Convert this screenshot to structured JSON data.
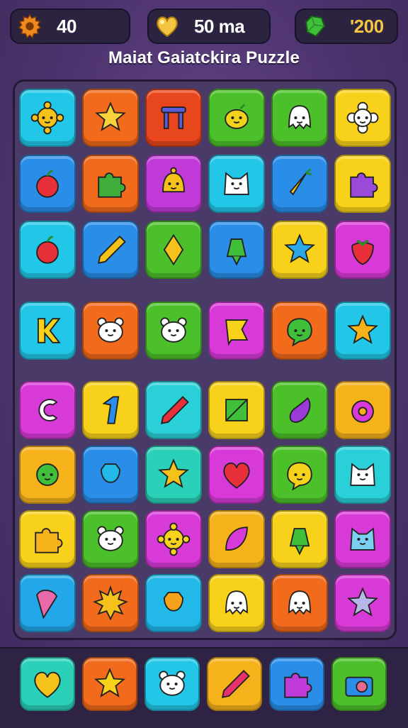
{
  "hud": {
    "left": {
      "value": "40",
      "icon": "gear-coin-icon",
      "color": "#f08a1c"
    },
    "center": {
      "value": "50 ma",
      "icon": "gold-heart-icon",
      "color": "#f5c542"
    },
    "right": {
      "value": "'200",
      "icon": "green-gem-icon",
      "color": "#3fbf3a"
    }
  },
  "title": "Maiat Gaiatckira Puzzle",
  "board": {
    "rows": [
      [
        {
          "bg": "#22c7e8",
          "icon": "sun-face-icon",
          "fg": "#f5c21b"
        },
        {
          "bg": "#f26a1b",
          "icon": "star-icon",
          "fg": "#f7d23a"
        },
        {
          "bg": "#e8461c",
          "icon": "table-icon",
          "fg": "#5a5ed8"
        },
        {
          "bg": "#4cc02a",
          "icon": "lemon-icon",
          "fg": "#f2d21c"
        },
        {
          "bg": "#4cc02a",
          "icon": "ghost-icon",
          "fg": "#ffffff"
        },
        {
          "bg": "#f8d21a",
          "icon": "flower-face-icon",
          "fg": "#ffffff"
        }
      ],
      [
        {
          "bg": "#2a8de8",
          "icon": "apple-icon",
          "fg": "#e8303a"
        },
        {
          "bg": "#f26a1b",
          "icon": "puzzle-piece-icon",
          "fg": "#3fae3a"
        },
        {
          "bg": "#c03ad8",
          "icon": "bell-face-icon",
          "fg": "#f5c21b"
        },
        {
          "bg": "#22c7e8",
          "icon": "cat-face-icon",
          "fg": "#ffffff"
        },
        {
          "bg": "#2a8de8",
          "icon": "carrot-icon",
          "fg": "#f5c21b"
        },
        {
          "bg": "#f8d21a",
          "icon": "puzzle-piece-icon",
          "fg": "#9a4ad8"
        }
      ],
      [
        {
          "bg": "#22c7e8",
          "icon": "apple-icon",
          "fg": "#e8303a"
        },
        {
          "bg": "#2a8de8",
          "icon": "pencil-icon",
          "fg": "#f5c21b"
        },
        {
          "bg": "#4cc02a",
          "icon": "diamond-icon",
          "fg": "#f5c21b"
        },
        {
          "bg": "#2a8de8",
          "icon": "bell-icon",
          "fg": "#3fbf3a"
        },
        {
          "bg": "#f8d21a",
          "icon": "star-icon",
          "fg": "#2aa8e8"
        },
        {
          "bg": "#d83ad8",
          "icon": "strawberry-icon",
          "fg": "#e8303a"
        }
      ],
      [
        {
          "bg": "#22c7e8",
          "icon": "letter-k-icon",
          "fg": "#f8d21a"
        },
        {
          "bg": "#f26a1b",
          "icon": "bear-face-icon",
          "fg": "#ffffff"
        },
        {
          "bg": "#4cc02a",
          "icon": "bear-face-icon",
          "fg": "#ffffff"
        },
        {
          "bg": "#d83ad8",
          "icon": "flag-icon",
          "fg": "#f8d21a"
        },
        {
          "bg": "#f26a1b",
          "icon": "speech-bubble-face-icon",
          "fg": "#3fbf3a"
        },
        {
          "bg": "#22c7e8",
          "icon": "star-icon",
          "fg": "#f5b21b"
        }
      ],
      [
        {
          "bg": "#d83ad8",
          "icon": "letter-c-icon",
          "fg": "#ffffff"
        },
        {
          "bg": "#f8d21a",
          "icon": "number-one-icon",
          "fg": "#2a8de8"
        },
        {
          "bg": "#2ad0d8",
          "icon": "pencil-icon",
          "fg": "#e8303a"
        },
        {
          "bg": "#f8d21a",
          "icon": "triangle-icon",
          "fg": "#3fbf3a"
        },
        {
          "bg": "#4cc02a",
          "icon": "eggplant-icon",
          "fg": "#9a3ad8"
        },
        {
          "bg": "#f5b21b",
          "icon": "donut-icon",
          "fg": "#d83ad8"
        }
      ],
      [
        {
          "bg": "#f5b21b",
          "icon": "circle-face-icon",
          "fg": "#3fbf3a"
        },
        {
          "bg": "#2a8de8",
          "icon": "bag-icon",
          "fg": "#22b8e8"
        },
        {
          "bg": "#2ad0b8",
          "icon": "star-icon",
          "fg": "#f5c21b"
        },
        {
          "bg": "#d83ad8",
          "icon": "heart-icon",
          "fg": "#e8303a"
        },
        {
          "bg": "#4cc02a",
          "icon": "speech-bubble-face-icon",
          "fg": "#f5d21b"
        },
        {
          "bg": "#2ad0d8",
          "icon": "cat-face-icon",
          "fg": "#ffffff"
        }
      ],
      [
        {
          "bg": "#f8d21a",
          "icon": "puzzle-piece-icon",
          "fg": "#f5b21b"
        },
        {
          "bg": "#4cc02a",
          "icon": "bear-face-icon",
          "fg": "#ffffff"
        },
        {
          "bg": "#d83ad8",
          "icon": "sun-face-icon",
          "fg": "#f5d21b"
        },
        {
          "bg": "#f5b21b",
          "icon": "leaf-icon",
          "fg": "#d83ad8"
        },
        {
          "bg": "#f8d21a",
          "icon": "bell-icon",
          "fg": "#3fbf3a"
        },
        {
          "bg": "#d83ad8",
          "icon": "cat-face-icon",
          "fg": "#7ad0f0"
        }
      ],
      [
        {
          "bg": "#22a8e8",
          "icon": "ice-cream-icon",
          "fg": "#e86aa8"
        },
        {
          "bg": "#f26a1b",
          "icon": "sun-icon",
          "fg": "#f5c21b"
        },
        {
          "bg": "#22b8e8",
          "icon": "bag-icon",
          "fg": "#f5a21b"
        },
        {
          "bg": "#f8d21a",
          "icon": "ghost-icon",
          "fg": "#ffffff"
        },
        {
          "bg": "#f26a1b",
          "icon": "ghost-icon",
          "fg": "#ffffff"
        },
        {
          "bg": "#d83ad8",
          "icon": "star-icon",
          "fg": "#b8b8e8"
        }
      ]
    ]
  },
  "tray": [
    {
      "bg": "#2ad0b8",
      "icon": "heart-icon",
      "fg": "#f5c21b"
    },
    {
      "bg": "#f26a1b",
      "icon": "star-icon",
      "fg": "#f8d21a"
    },
    {
      "bg": "#22c7e8",
      "icon": "bear-face-icon",
      "fg": "#ffffff"
    },
    {
      "bg": "#f5b21b",
      "icon": "pencil-icon",
      "fg": "#e8306a"
    },
    {
      "bg": "#2a8de8",
      "icon": "puzzle-piece-icon",
      "fg": "#c03ad8"
    },
    {
      "bg": "#4cc02a",
      "icon": "camera-icon",
      "fg": "#2a8de8"
    }
  ]
}
